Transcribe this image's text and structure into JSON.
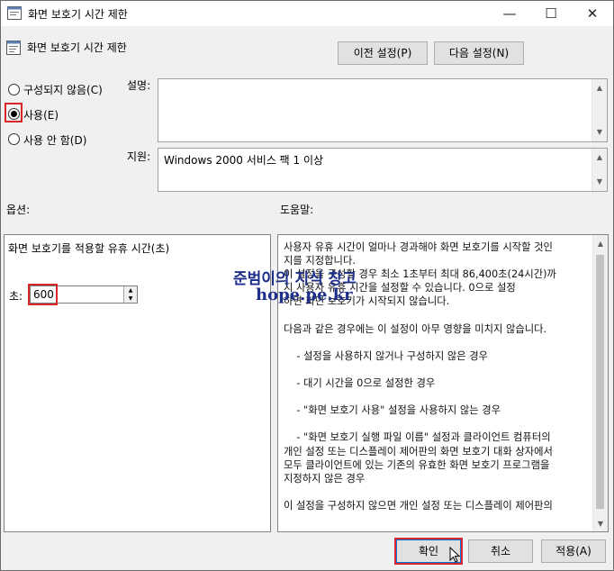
{
  "window": {
    "title": "화면 보호기 시간 제한",
    "minimize": "—",
    "maximize": "☐",
    "close": "✕"
  },
  "header": {
    "policy_name": "화면 보호기 시간 제한",
    "prev_button": "이전 설정(P)",
    "next_button": "다음 설정(N)"
  },
  "state": {
    "options": [
      {
        "label": "구성되지 않음(C)",
        "selected": false
      },
      {
        "label": "사용(E)",
        "selected": true
      },
      {
        "label": "사용 안 함(D)",
        "selected": false
      }
    ]
  },
  "comment": {
    "label": "설명:",
    "value": ""
  },
  "supported": {
    "label": "지원:",
    "value": "Windows 2000 서비스 팩 1 이상"
  },
  "options_section": {
    "label": "옵션:",
    "heading": "화면 보호기를 적용할 유휴 시간(초)",
    "seconds_label": "초:",
    "seconds_value": "600"
  },
  "help_section": {
    "label": "도움말:",
    "lines": [
      "사용자 유휴 시간이 얼마나 경과해야 화면 보호기를 시작할 것인",
      "지를 지정합니다.",
      "이 설정을 구성할 경우 최소 1초부터 최대 86,400초(24시간)까",
      "지 사용자 유휴 시간을 설정할 수 있습니다. 0으로 설정",
      "하면 화면 보호기가 시작되지 않습니다.",
      "",
      "다음과 같은 경우에는 이 설정이 아무 영향을 미치지 않습니다.",
      "",
      "    - 설정을 사용하지 않거나 구성하지 않은 경우",
      "",
      "    - 대기 시간을 0으로 설정한 경우",
      "",
      "    - \"화면 보호기 사용\" 설정을 사용하지 않는 경우",
      "",
      "    - \"화면 보호기 실행 파일 이름\" 설정과 클라이언트 컴퓨터의",
      "개인 설정 또는 디스플레이 제어판의 화면 보호기 대화 상자에서",
      "모두 클라이언트에 있는 기존의 유효한 화면 보호기 프로그램을",
      "지정하지 않은 경우",
      "",
      "이 설정을 구성하지 않으면 개인 설정 또는 디스플레이 제어판의"
    ]
  },
  "watermark": {
    "line1": "준범이의 지식 창고",
    "line2": "hope.pe.kr"
  },
  "footer": {
    "ok": "확인",
    "cancel": "취소",
    "apply": "적용(A)"
  },
  "colors": {
    "highlight": "#d9262b",
    "watermark": "#1d2f8a"
  }
}
